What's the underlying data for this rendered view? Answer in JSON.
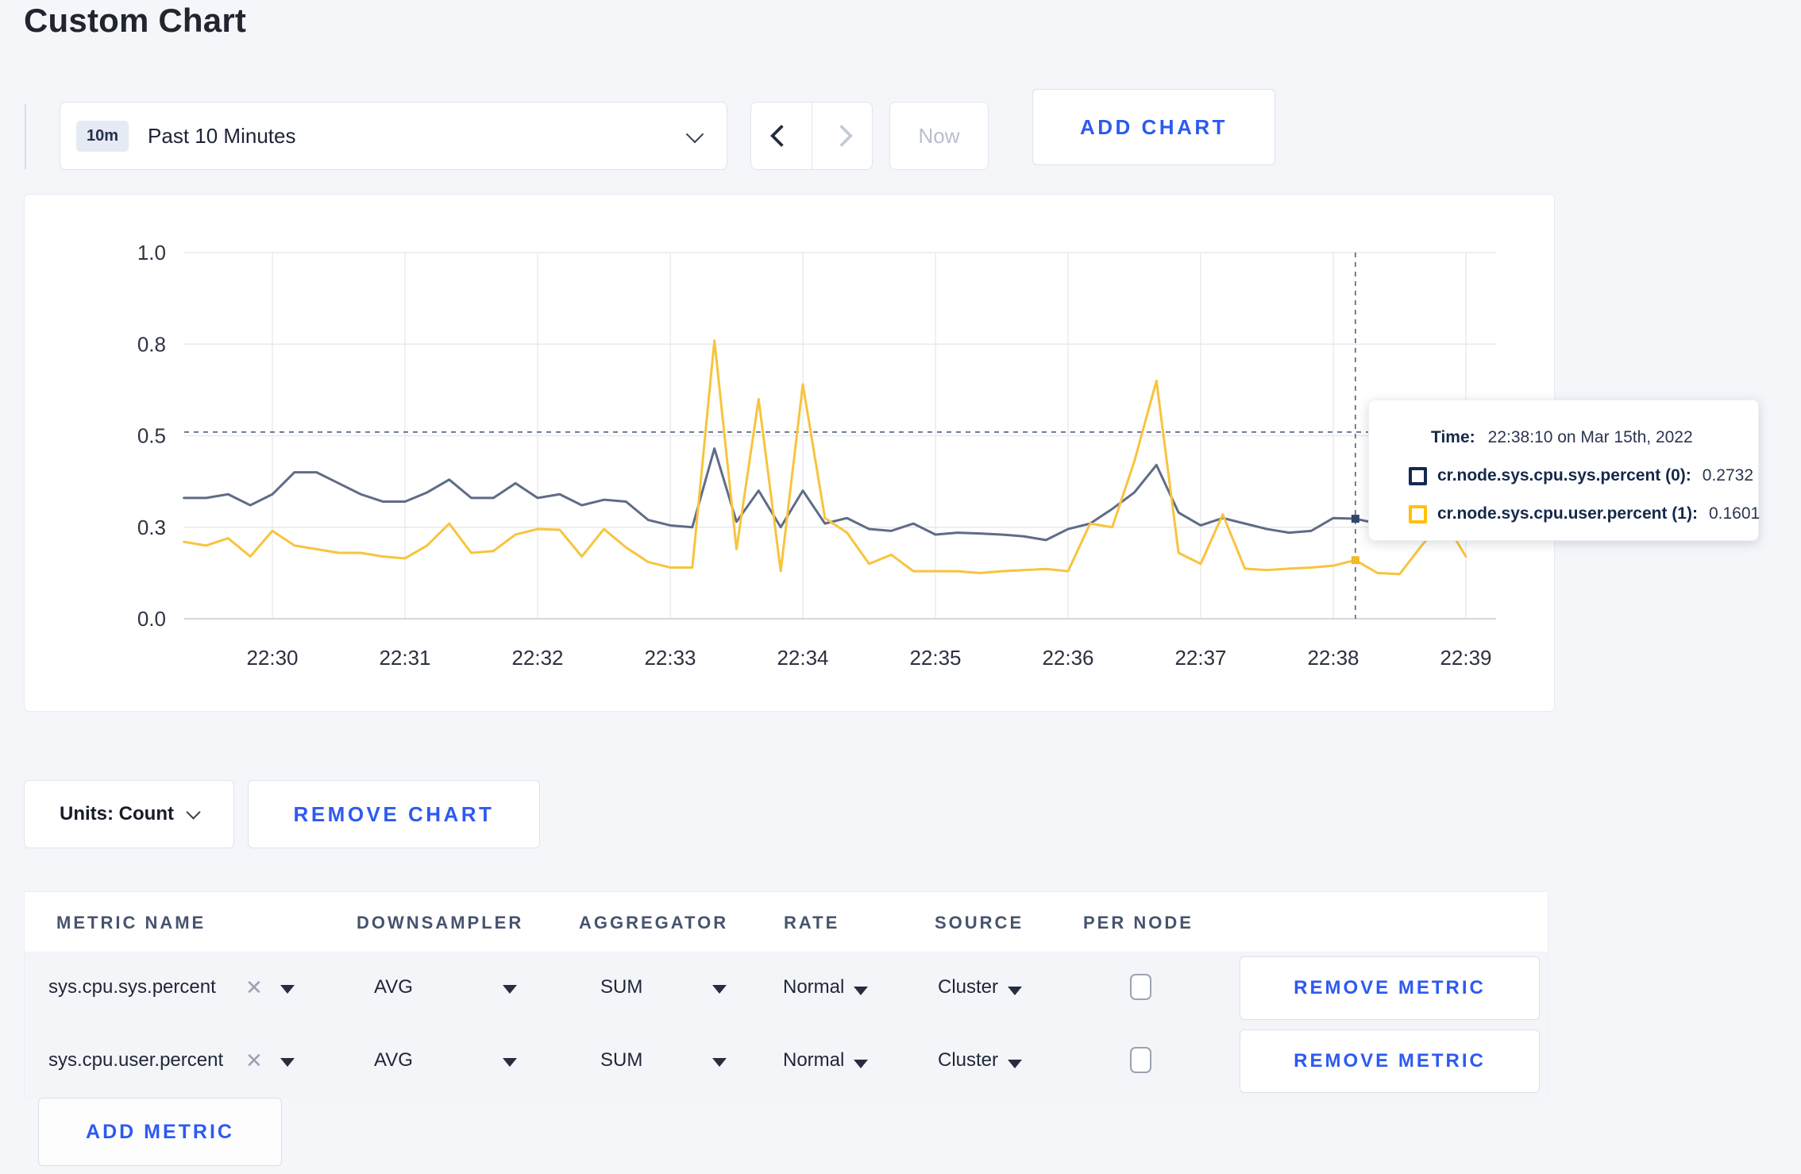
{
  "page": {
    "title": "Custom Chart"
  },
  "toolbar": {
    "time_range": {
      "badge": "10m",
      "label": "Past 10 Minutes"
    },
    "now_label": "Now",
    "add_chart_label": "ADD CHART"
  },
  "chart": {
    "tooltip": {
      "time_label": "Time:",
      "time_value": "22:38:10 on Mar 15th, 2022",
      "rows": [
        {
          "label": "cr.node.sys.cpu.sys.percent (0):",
          "value": "0.2732",
          "swatch": "#14294E"
        },
        {
          "label": "cr.node.sys.cpu.user.percent (1):",
          "value": "0.1601",
          "swatch": "#FFC008"
        }
      ]
    }
  },
  "chart_data": {
    "type": "line",
    "title": "",
    "xlabel": "",
    "ylabel": "",
    "ylim": [
      0,
      1.0
    ],
    "grid": true,
    "yticks": {
      "values": [
        0,
        0.25,
        0.5,
        0.75,
        1.0
      ],
      "labels": [
        "0.0",
        "0.3",
        "0.5",
        "0.8",
        "1.0"
      ]
    },
    "xticks": [
      "22:30",
      "22:31",
      "22:32",
      "22:33",
      "22:34",
      "22:35",
      "22:36",
      "22:37",
      "22:38",
      "22:39"
    ],
    "x": [
      "22:29:20",
      "22:29:30",
      "22:29:40",
      "22:29:50",
      "22:30:00",
      "22:30:10",
      "22:30:20",
      "22:30:30",
      "22:30:40",
      "22:30:50",
      "22:31:00",
      "22:31:10",
      "22:31:20",
      "22:31:30",
      "22:31:40",
      "22:31:50",
      "22:32:00",
      "22:32:10",
      "22:32:20",
      "22:32:30",
      "22:32:40",
      "22:32:50",
      "22:33:00",
      "22:33:10",
      "22:33:20",
      "22:33:30",
      "22:33:40",
      "22:33:50",
      "22:34:00",
      "22:34:10",
      "22:34:20",
      "22:34:30",
      "22:34:40",
      "22:34:50",
      "22:35:00",
      "22:35:10",
      "22:35:20",
      "22:35:30",
      "22:35:40",
      "22:35:50",
      "22:36:00",
      "22:36:10",
      "22:36:20",
      "22:36:30",
      "22:36:40",
      "22:36:50",
      "22:37:00",
      "22:37:10",
      "22:37:20",
      "22:37:30",
      "22:37:40",
      "22:37:50",
      "22:38:00",
      "22:38:10",
      "22:38:20",
      "22:38:30",
      "22:38:40",
      "22:38:50",
      "22:39:00"
    ],
    "series": [
      {
        "name": "cr.node.sys.cpu.sys.percent",
        "color": "#5F6C87",
        "marker_color": "#35466B",
        "values": [
          0.33,
          0.33,
          0.34,
          0.31,
          0.34,
          0.4,
          0.4,
          0.37,
          0.34,
          0.32,
          0.32,
          0.345,
          0.38,
          0.33,
          0.33,
          0.37,
          0.33,
          0.34,
          0.31,
          0.325,
          0.32,
          0.27,
          0.255,
          0.25,
          0.465,
          0.265,
          0.35,
          0.25,
          0.35,
          0.26,
          0.275,
          0.245,
          0.24,
          0.26,
          0.23,
          0.235,
          0.233,
          0.23,
          0.225,
          0.215,
          0.245,
          0.26,
          0.3,
          0.345,
          0.42,
          0.29,
          0.255,
          0.275,
          0.26,
          0.245,
          0.235,
          0.24,
          0.275,
          0.2732,
          0.26,
          0.265,
          0.275,
          0.28,
          0.27
        ]
      },
      {
        "name": "cr.node.sys.cpu.user.percent",
        "color": "#F8C43D",
        "marker_color": "#F2B928",
        "values": [
          0.21,
          0.2,
          0.22,
          0.17,
          0.24,
          0.2,
          0.19,
          0.18,
          0.18,
          0.17,
          0.165,
          0.2,
          0.26,
          0.18,
          0.185,
          0.23,
          0.245,
          0.243,
          0.17,
          0.245,
          0.195,
          0.155,
          0.14,
          0.14,
          0.76,
          0.19,
          0.6,
          0.13,
          0.64,
          0.275,
          0.235,
          0.15,
          0.175,
          0.13,
          0.13,
          0.13,
          0.125,
          0.13,
          0.133,
          0.136,
          0.13,
          0.26,
          0.25,
          0.43,
          0.65,
          0.18,
          0.15,
          0.285,
          0.137,
          0.133,
          0.137,
          0.14,
          0.145,
          0.1601,
          0.125,
          0.122,
          0.2,
          0.27,
          0.17
        ]
      }
    ],
    "crosshair": {
      "time": "22:38:10",
      "index": 53,
      "y_value": 0.51
    },
    "legend_position": "none"
  },
  "controls": {
    "units_label": "Units: Count",
    "remove_chart_label": "REMOVE CHART",
    "add_metric_label": "ADD METRIC"
  },
  "metrics_table": {
    "columns": [
      "METRIC NAME",
      "DOWNSAMPLER",
      "AGGREGATOR",
      "RATE",
      "SOURCE",
      "PER NODE"
    ],
    "rows": [
      {
        "metric": "sys.cpu.sys.percent",
        "downsampler": "AVG",
        "aggregator": "SUM",
        "rate": "Normal",
        "source": "Cluster",
        "per_node": false,
        "remove_label": "REMOVE METRIC"
      },
      {
        "metric": "sys.cpu.user.percent",
        "downsampler": "AVG",
        "aggregator": "SUM",
        "rate": "Normal",
        "source": "Cluster",
        "per_node": false,
        "remove_label": "REMOVE METRIC"
      }
    ]
  }
}
